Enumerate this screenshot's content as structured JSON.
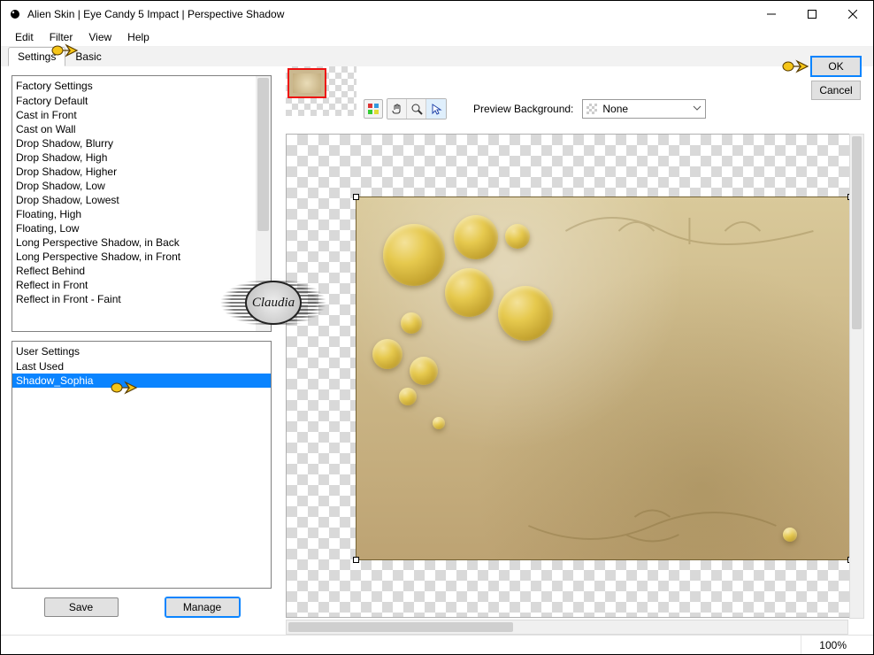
{
  "window": {
    "title": "Alien Skin | Eye Candy 5 Impact | Perspective Shadow"
  },
  "menu": {
    "items": [
      "Edit",
      "Filter",
      "View",
      "Help"
    ]
  },
  "tabs": {
    "settings": "Settings",
    "basic": "Basic",
    "active": "settings"
  },
  "buttons": {
    "ok": "OK",
    "cancel": "Cancel",
    "save": "Save",
    "manage": "Manage"
  },
  "preview": {
    "bg_label": "Preview Background:",
    "bg_value": "None"
  },
  "factory": {
    "header": "Factory Settings",
    "items": [
      "Factory Default",
      "Cast in Front",
      "Cast on Wall",
      "Drop Shadow, Blurry",
      "Drop Shadow, High",
      "Drop Shadow, Higher",
      "Drop Shadow, Low",
      "Drop Shadow, Lowest",
      "Floating, High",
      "Floating, Low",
      "Long Perspective Shadow, in Back",
      "Long Perspective Shadow, in Front",
      "Reflect Behind",
      "Reflect in Front",
      "Reflect in Front - Faint"
    ]
  },
  "user": {
    "header": "User Settings",
    "items": [
      "Last Used",
      "Shadow_Sophia"
    ],
    "selected": "Shadow_Sophia"
  },
  "status": {
    "zoom": "100%"
  },
  "watermark": "Claudia"
}
